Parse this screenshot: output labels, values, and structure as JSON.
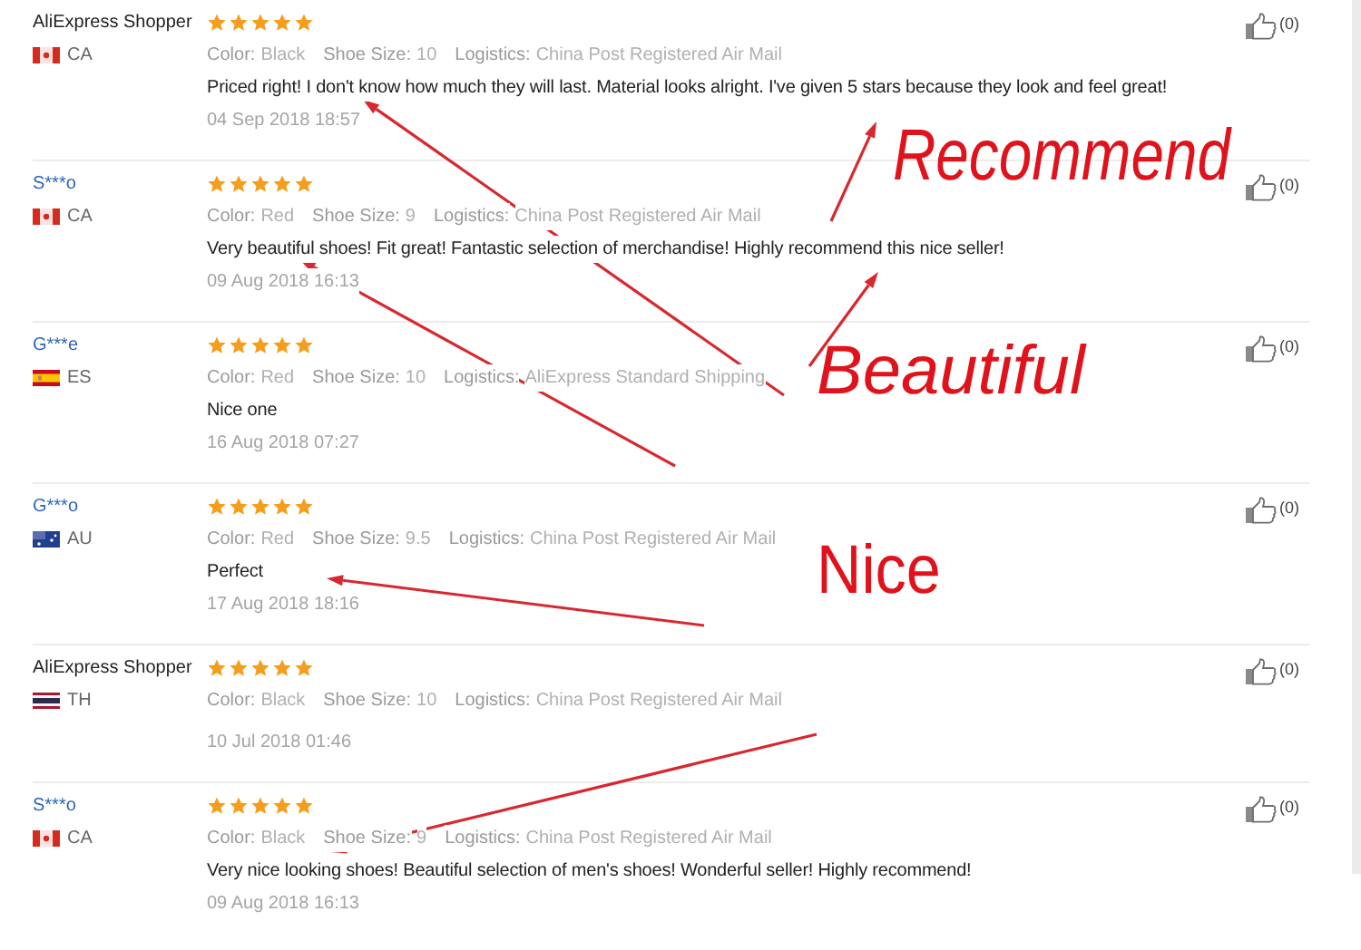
{
  "reviews": [
    {
      "name": "AliExpress Shopper",
      "kind": "shopper",
      "flag": {
        "kind": "canada"
      },
      "country": "CA",
      "stars": 5,
      "fields": [
        {
          "label": "Color:",
          "value": "Black"
        },
        {
          "label": "Shoe Size:",
          "value": "10"
        },
        {
          "label": "Logistics:",
          "value": "China Post Registered Air Mail"
        }
      ],
      "text": "Priced right! I don't know how much they will last. Material looks alright. I've given 5 stars because they look and feel great!",
      "date": "04 Sep 2018 18:57",
      "likes": "(0)"
    },
    {
      "name": "S***o",
      "kind": "member",
      "flag": {
        "kind": "canada"
      },
      "country": "CA",
      "stars": 5,
      "fields": [
        {
          "label": "Color:",
          "value": "Red"
        },
        {
          "label": "Shoe Size:",
          "value": "9"
        },
        {
          "label": "Logistics:",
          "value": "China Post Registered Air Mail"
        }
      ],
      "text": "Very beautiful shoes! Fit great! Fantastic selection of merchandise! Highly recommend this nice seller!",
      "date": "09 Aug 2018 16:13",
      "likes": "(0)"
    },
    {
      "name": "G***e",
      "kind": "member",
      "flag": {
        "kind": "spain"
      },
      "country": "ES",
      "stars": 5,
      "fields": [
        {
          "label": "Color:",
          "value": "Red"
        },
        {
          "label": "Shoe Size:",
          "value": "10"
        },
        {
          "label": "Logistics:",
          "value": "AliExpress Standard Shipping"
        }
      ],
      "text": "Nice one",
      "date": "16 Aug 2018 07:27",
      "likes": "(0)"
    },
    {
      "name": "G***o",
      "kind": "member",
      "flag": {
        "kind": "australia"
      },
      "country": "AU",
      "stars": 5,
      "fields": [
        {
          "label": "Color:",
          "value": "Red"
        },
        {
          "label": "Shoe Size:",
          "value": "9.5"
        },
        {
          "label": "Logistics:",
          "value": "China Post Registered Air Mail"
        }
      ],
      "text": "Perfect",
      "date": "17 Aug 2018 18:16",
      "likes": "(0)"
    },
    {
      "name": "AliExpress Shopper",
      "kind": "shopper",
      "flag": {
        "kind": "thailand"
      },
      "country": "TH",
      "stars": 5,
      "fields": [
        {
          "label": "Color:",
          "value": "Black"
        },
        {
          "label": "Shoe Size:",
          "value": "10"
        },
        {
          "label": "Logistics:",
          "value": "China Post Registered Air Mail"
        }
      ],
      "date": "10 Jul 2018 01:46",
      "likes": "(0)"
    },
    {
      "name": "S***o",
      "kind": "member",
      "flag": {
        "kind": "canada"
      },
      "country": "CA",
      "stars": 5,
      "fields": [
        {
          "label": "Color:",
          "value": "Black"
        },
        {
          "label": "Shoe Size:",
          "value": "9"
        },
        {
          "label": "Logistics:",
          "value": "China Post Registered Air Mail"
        }
      ],
      "text": "Very nice looking shoes! Beautiful selection of men's shoes! Wonderful seller! Highly recommend!",
      "date": "09 Aug 2018 16:13",
      "likes": "(0)"
    }
  ],
  "annotations": [
    {
      "text": "Recommend",
      "kind": "italic"
    },
    {
      "text": "Beautiful",
      "kind": "italic"
    },
    {
      "text": "Nice",
      "kind": "plain"
    }
  ]
}
